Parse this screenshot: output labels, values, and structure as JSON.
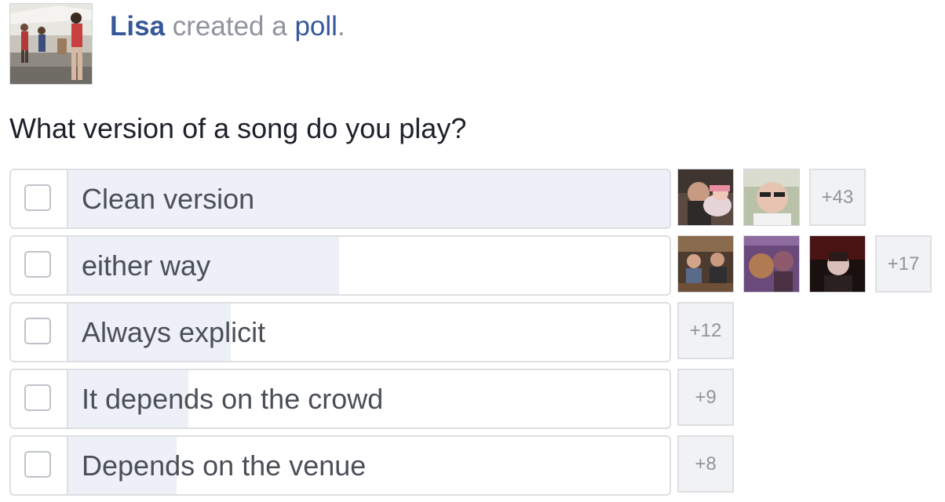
{
  "post": {
    "author": "Lisa",
    "action": "created a",
    "object": "poll",
    "punctuation": "."
  },
  "question": "What version of a song do you play?",
  "options": [
    {
      "label": "Clean version",
      "fill": 1.0,
      "voter_avatars": 2,
      "more": "+43"
    },
    {
      "label": "either way",
      "fill": 0.45,
      "voter_avatars": 3,
      "more": "+17"
    },
    {
      "label": "Always explicit",
      "fill": 0.27,
      "voter_avatars": 0,
      "more": "+12"
    },
    {
      "label": "It depends on the crowd",
      "fill": 0.2,
      "voter_avatars": 0,
      "more": "+9"
    },
    {
      "label": "Depends on the venue",
      "fill": 0.18,
      "voter_avatars": 0,
      "more": "+8"
    }
  ],
  "colors": {
    "link": "#365899",
    "muted": "#90949c",
    "bar_fill": "#edf0f6",
    "border": "#dddfe2"
  }
}
